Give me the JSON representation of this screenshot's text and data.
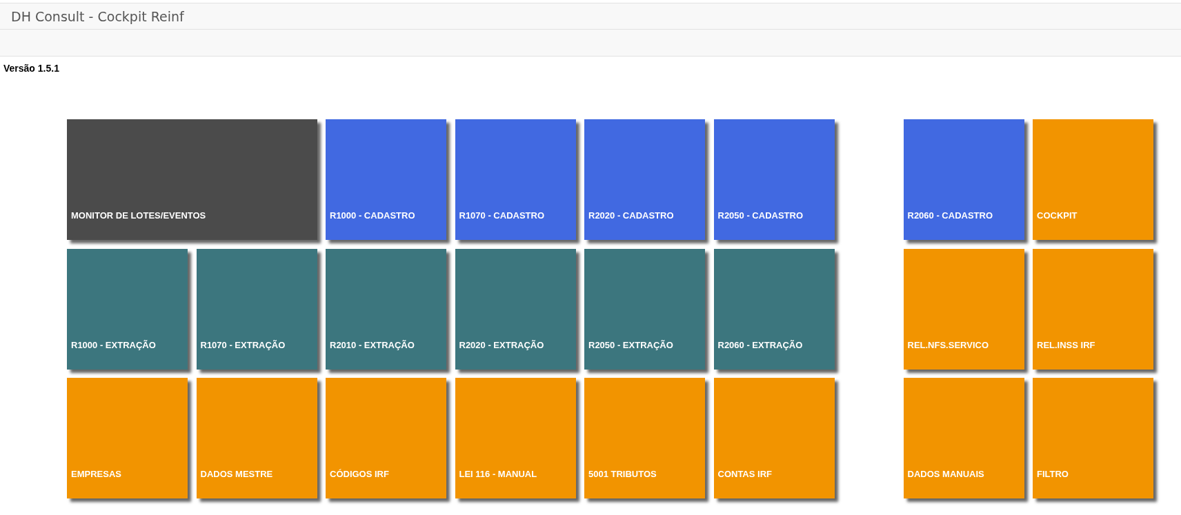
{
  "window": {
    "title": "DH Consult - Cockpit Reinf"
  },
  "version": "Versão 1.5.1",
  "tile_groups": [
    {
      "tiles": [
        {
          "label": "MONITOR DE LOTES/EVENTOS",
          "color": "#4b4b4b",
          "wide": true
        },
        {
          "label": "R1000 - CADASTRO",
          "color": "#4169e1",
          "wide": false
        },
        {
          "label": "R1070 - CADASTRO",
          "color": "#4169e1",
          "wide": false
        },
        {
          "label": "R2020 - CADASTRO",
          "color": "#4169e1",
          "wide": false
        },
        {
          "label": "R2050 - CADASTRO",
          "color": "#4169e1",
          "wide": false
        },
        {
          "label": "R1000 - EXTRAÇÃO",
          "color": "#3c767e",
          "wide": false
        },
        {
          "label": "R1070 - EXTRAÇÃO",
          "color": "#3c767e",
          "wide": false
        },
        {
          "label": "R2010 - EXTRAÇÃO",
          "color": "#3c767e",
          "wide": false
        },
        {
          "label": "R2020 - EXTRAÇÃO",
          "color": "#3c767e",
          "wide": false
        },
        {
          "label": "R2050 - EXTRAÇÃO",
          "color": "#3c767e",
          "wide": false
        },
        {
          "label": "R2060 - EXTRAÇÃO",
          "color": "#3c767e",
          "wide": false
        },
        {
          "label": "EMPRESAS",
          "color": "#f29400",
          "wide": false
        },
        {
          "label": "DADOS MESTRE",
          "color": "#f29400",
          "wide": false
        },
        {
          "label": "CÓDIGOS IRF",
          "color": "#f29400",
          "wide": false
        },
        {
          "label": "LEI 116 - MANUAL",
          "color": "#f29400",
          "wide": false
        },
        {
          "label": "5001 TRIBUTOS",
          "color": "#f29400",
          "wide": false
        },
        {
          "label": "CONTAS IRF",
          "color": "#f29400",
          "wide": false
        }
      ]
    },
    {
      "tiles": [
        {
          "label": "R2060 - CADASTRO",
          "color": "#4169e1",
          "wide": false
        },
        {
          "label": "COCKPIT",
          "color": "#f29400",
          "wide": false
        },
        {
          "label": "REL.NFS.SERVICO",
          "color": "#f29400",
          "wide": false
        },
        {
          "label": "REL.INSS IRF",
          "color": "#f29400",
          "wide": false
        },
        {
          "label": "DADOS MANUAIS",
          "color": "#f29400",
          "wide": false
        },
        {
          "label": "FILTRO",
          "color": "#f29400",
          "wide": false
        }
      ]
    }
  ]
}
